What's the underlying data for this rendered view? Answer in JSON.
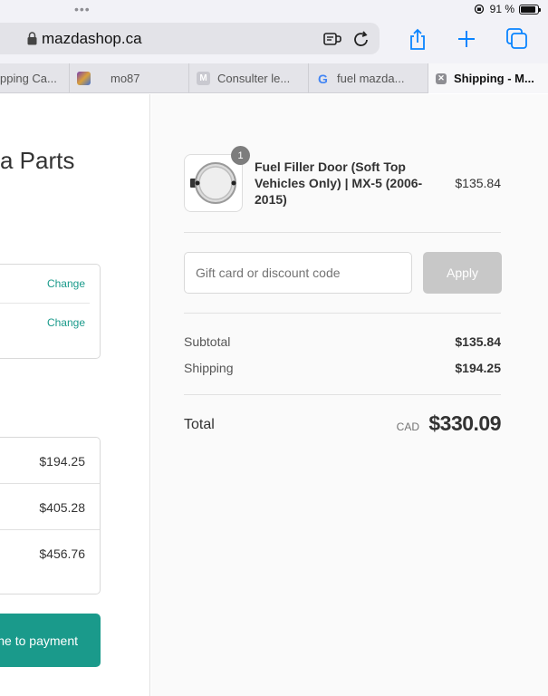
{
  "status_bar": {
    "dots": "•••",
    "battery_text": "91 %",
    "battery_level": 0.91
  },
  "browser": {
    "url": "mazdashop.ca",
    "tabs": [
      {
        "label": "pping Ca...",
        "favicon": "cart-favicon",
        "active": false
      },
      {
        "label": "mo87",
        "favicon": "image-favicon",
        "active": false
      },
      {
        "label": "Consulter le...",
        "favicon": "M",
        "active": false
      },
      {
        "label": "fuel mazda...",
        "favicon": "G",
        "active": false
      },
      {
        "label": "Shipping - M...",
        "favicon": "close-icon",
        "active": true
      }
    ],
    "icons": [
      "lock-icon",
      "reader-icon",
      "reload-icon",
      "share-icon",
      "plus-icon",
      "tabs-icon"
    ]
  },
  "left": {
    "title": "a Parts",
    "change_1": "Change",
    "change_2": "Change",
    "shipping_prices": [
      "$194.25",
      "$405.28",
      "$456.76"
    ],
    "continue_label": "ne to payment"
  },
  "summary": {
    "product": {
      "quantity": "1",
      "name": "Fuel Filler Door (Soft Top Vehicles Only) | MX-5 (2006-2015)",
      "price": "$135.84"
    },
    "discount_placeholder": "Gift card or discount code",
    "apply_label": "Apply",
    "subtotal_label": "Subtotal",
    "subtotal_value": "$135.84",
    "shipping_label": "Shipping",
    "shipping_value": "$194.25",
    "total_label": "Total",
    "currency": "CAD",
    "total_value": "$330.09"
  },
  "colors": {
    "accent": "#1a9a8b",
    "apply_disabled": "#c8c8c8",
    "badge": "#7d7d7d"
  }
}
